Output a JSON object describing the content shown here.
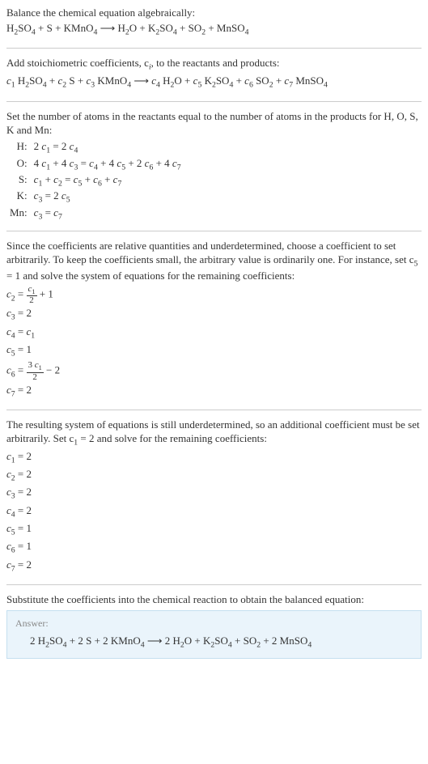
{
  "s1": {
    "l1": "Balance the chemical equation algebraically:"
  },
  "s2": {
    "l1": "Add stoichiometric coefficients, c",
    "l1b": ", to the reactants and products:"
  },
  "s3": {
    "l1": "Set the number of atoms in the reactants equal to the number of atoms in the products for H, O, S, K and Mn:"
  },
  "s4": {
    "l1": "Since the coefficients are relative quantities and underdetermined, choose a coefficient to set arbitrarily. To keep the coefficients small, the arbitrary value is ordinarily one. For instance, set c",
    "l1b": " = 1 and solve the system of equations for the remaining coefficients:"
  },
  "s5": {
    "l1": "The resulting system of equations is still underdetermined, so an additional coefficient must be set arbitrarily. Set c",
    "l1b": " = 2 and solve for the remaining coefficients:",
    "r1": " = 2",
    "r2": " = 2",
    "r3": " = 2",
    "r4": " = 2",
    "r5": " = 1",
    "r6": " = 1",
    "r7": " = 2"
  },
  "s6": {
    "l1": "Substitute the coefficients into the chemical reaction to obtain the balanced equation:"
  },
  "answer": {
    "label": "Answer:"
  },
  "labels": {
    "H": "H:",
    "O": "O:",
    "S": "S:",
    "K": "K:",
    "Mn": "Mn:"
  },
  "chart_data": {
    "type": "table",
    "title": "Chemical equation balancing",
    "reactants": [
      "H2SO4",
      "S",
      "KMnO4"
    ],
    "products": [
      "H2O",
      "K2SO4",
      "SO2",
      "MnSO4"
    ],
    "elements": [
      "H",
      "O",
      "S",
      "K",
      "Mn"
    ],
    "balance_equations": {
      "H": "2 c1 = 2 c4",
      "O": "4 c1 + 4 c3 = c4 + 4 c5 + 2 c6 + 4 c7",
      "S": "c1 + c2 = c5 + c6 + c7",
      "K": "c3 = 2 c5",
      "Mn": "c3 = c7"
    },
    "first_solution_at_c5_1": {
      "c2": "c1/2 + 1",
      "c3": 2,
      "c4": "c1",
      "c5": 1,
      "c6": "3 c1/2 - 2",
      "c7": 2
    },
    "final_coefficients_at_c1_2": {
      "c1": 2,
      "c2": 2,
      "c3": 2,
      "c4": 2,
      "c5": 1,
      "c6": 1,
      "c7": 2
    },
    "balanced_equation": "2 H2SO4 + 2 S + 2 KMnO4 -> 2 H2O + K2SO4 + SO2 + 2 MnSO4"
  }
}
